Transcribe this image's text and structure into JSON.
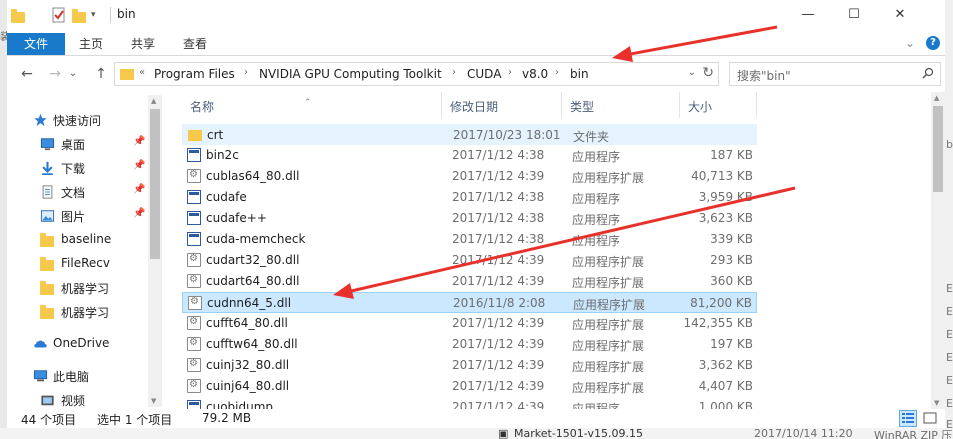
{
  "window": {
    "title": "bin",
    "minimize_glyph": "—",
    "maximize_glyph": "☐",
    "close_glyph": "✕"
  },
  "ribbon": {
    "tabs": [
      {
        "label": "文件",
        "active": true
      },
      {
        "label": "主页",
        "active": false
      },
      {
        "label": "共享",
        "active": false
      },
      {
        "label": "查看",
        "active": false
      }
    ],
    "collapse_glyph": "⌄",
    "help_glyph": "?"
  },
  "address": {
    "overflow_glyph": "«",
    "crumbs": [
      "Program Files",
      "NVIDIA GPU Computing Toolkit",
      "CUDA",
      "v8.0",
      "bin"
    ],
    "separator": "›",
    "dropdown_glyph": "⌄",
    "refresh_glyph": "↻"
  },
  "search": {
    "placeholder": "搜索\"bin\""
  },
  "nav": {
    "back": "←",
    "forward": "→",
    "recent": "⌄",
    "up": "↑",
    "items": [
      {
        "label": "快速访问",
        "icon": "star-icon",
        "pinned": false
      },
      {
        "label": "桌面",
        "icon": "desktop-icon",
        "pinned": true
      },
      {
        "label": "下载",
        "icon": "download-icon",
        "pinned": true
      },
      {
        "label": "文档",
        "icon": "document-icon",
        "pinned": true
      },
      {
        "label": "图片",
        "icon": "picture-icon",
        "pinned": true
      },
      {
        "label": "baseline",
        "icon": "folder-icon",
        "pinned": false
      },
      {
        "label": "FileRecv",
        "icon": "folder-icon",
        "pinned": false
      },
      {
        "label": "机器学习",
        "icon": "folder-icon",
        "pinned": false
      },
      {
        "label": "机器学习",
        "icon": "folder-icon",
        "pinned": false
      },
      {
        "label": "OneDrive",
        "icon": "cloud-icon",
        "pinned": false
      },
      {
        "label": "此电脑",
        "icon": "computer-icon",
        "pinned": false
      },
      {
        "label": "视频",
        "icon": "video-icon",
        "pinned": false
      }
    ]
  },
  "columns": {
    "name": "名称",
    "date": "修改日期",
    "type": "类型",
    "size": "大小"
  },
  "files": [
    {
      "name": "crt",
      "date": "2017/10/23 18:01",
      "type": "文件夹",
      "size": "",
      "icon": "folder-icon",
      "state": "hover"
    },
    {
      "name": "bin2c",
      "date": "2017/1/12 4:38",
      "type": "应用程序",
      "size": "187 KB",
      "icon": "exe-icon",
      "state": ""
    },
    {
      "name": "cublas64_80.dll",
      "date": "2017/1/12 4:39",
      "type": "应用程序扩展",
      "size": "40,713 KB",
      "icon": "dll-icon",
      "state": ""
    },
    {
      "name": "cudafe",
      "date": "2017/1/12 4:38",
      "type": "应用程序",
      "size": "3,959 KB",
      "icon": "exe-icon",
      "state": ""
    },
    {
      "name": "cudafe++",
      "date": "2017/1/12 4:38",
      "type": "应用程序",
      "size": "3,623 KB",
      "icon": "exe-icon",
      "state": ""
    },
    {
      "name": "cuda-memcheck",
      "date": "2017/1/12 4:38",
      "type": "应用程序",
      "size": "339 KB",
      "icon": "exe-icon",
      "state": ""
    },
    {
      "name": "cudart32_80.dll",
      "date": "2017/1/12 4:39",
      "type": "应用程序扩展",
      "size": "293 KB",
      "icon": "dll-icon",
      "state": ""
    },
    {
      "name": "cudart64_80.dll",
      "date": "2017/1/12 4:39",
      "type": "应用程序扩展",
      "size": "360 KB",
      "icon": "dll-icon",
      "state": ""
    },
    {
      "name": "cudnn64_5.dll",
      "date": "2016/11/8 2:08",
      "type": "应用程序扩展",
      "size": "81,200 KB",
      "icon": "dll-icon",
      "state": "sel"
    },
    {
      "name": "cufft64_80.dll",
      "date": "2017/1/12 4:39",
      "type": "应用程序扩展",
      "size": "142,355 KB",
      "icon": "dll-icon",
      "state": ""
    },
    {
      "name": "cufftw64_80.dll",
      "date": "2017/1/12 4:39",
      "type": "应用程序扩展",
      "size": "197 KB",
      "icon": "dll-icon",
      "state": ""
    },
    {
      "name": "cuinj32_80.dll",
      "date": "2017/1/12 4:39",
      "type": "应用程序扩展",
      "size": "3,362 KB",
      "icon": "dll-icon",
      "state": ""
    },
    {
      "name": "cuinj64_80.dll",
      "date": "2017/1/12 4:39",
      "type": "应用程序扩展",
      "size": "4,407 KB",
      "icon": "dll-icon",
      "state": ""
    },
    {
      "name": "cuobjdump",
      "date": "2017/1/12 4:39",
      "type": "应用程序",
      "size": "1,000 KB",
      "icon": "exe-icon",
      "state": ""
    }
  ],
  "status": {
    "count": "44 个项目",
    "selected": "选中 1 个项目",
    "size": "79.2 MB"
  },
  "background": {
    "bottom_name": "Market-1501-v15.09.15",
    "bottom_date": "2017/10/14 11:20",
    "bottom_type": "WinRAR ZIP 压",
    "right_glyphs": [
      "b",
      "E",
      "E",
      "E",
      "E",
      "E",
      "E",
      "E"
    ],
    "left_glyph": "装"
  },
  "colors": {
    "accent": "#1979ca",
    "selection": "#cce8ff",
    "hover": "#e5f3ff",
    "annotation_arrow": "#e8312a"
  }
}
